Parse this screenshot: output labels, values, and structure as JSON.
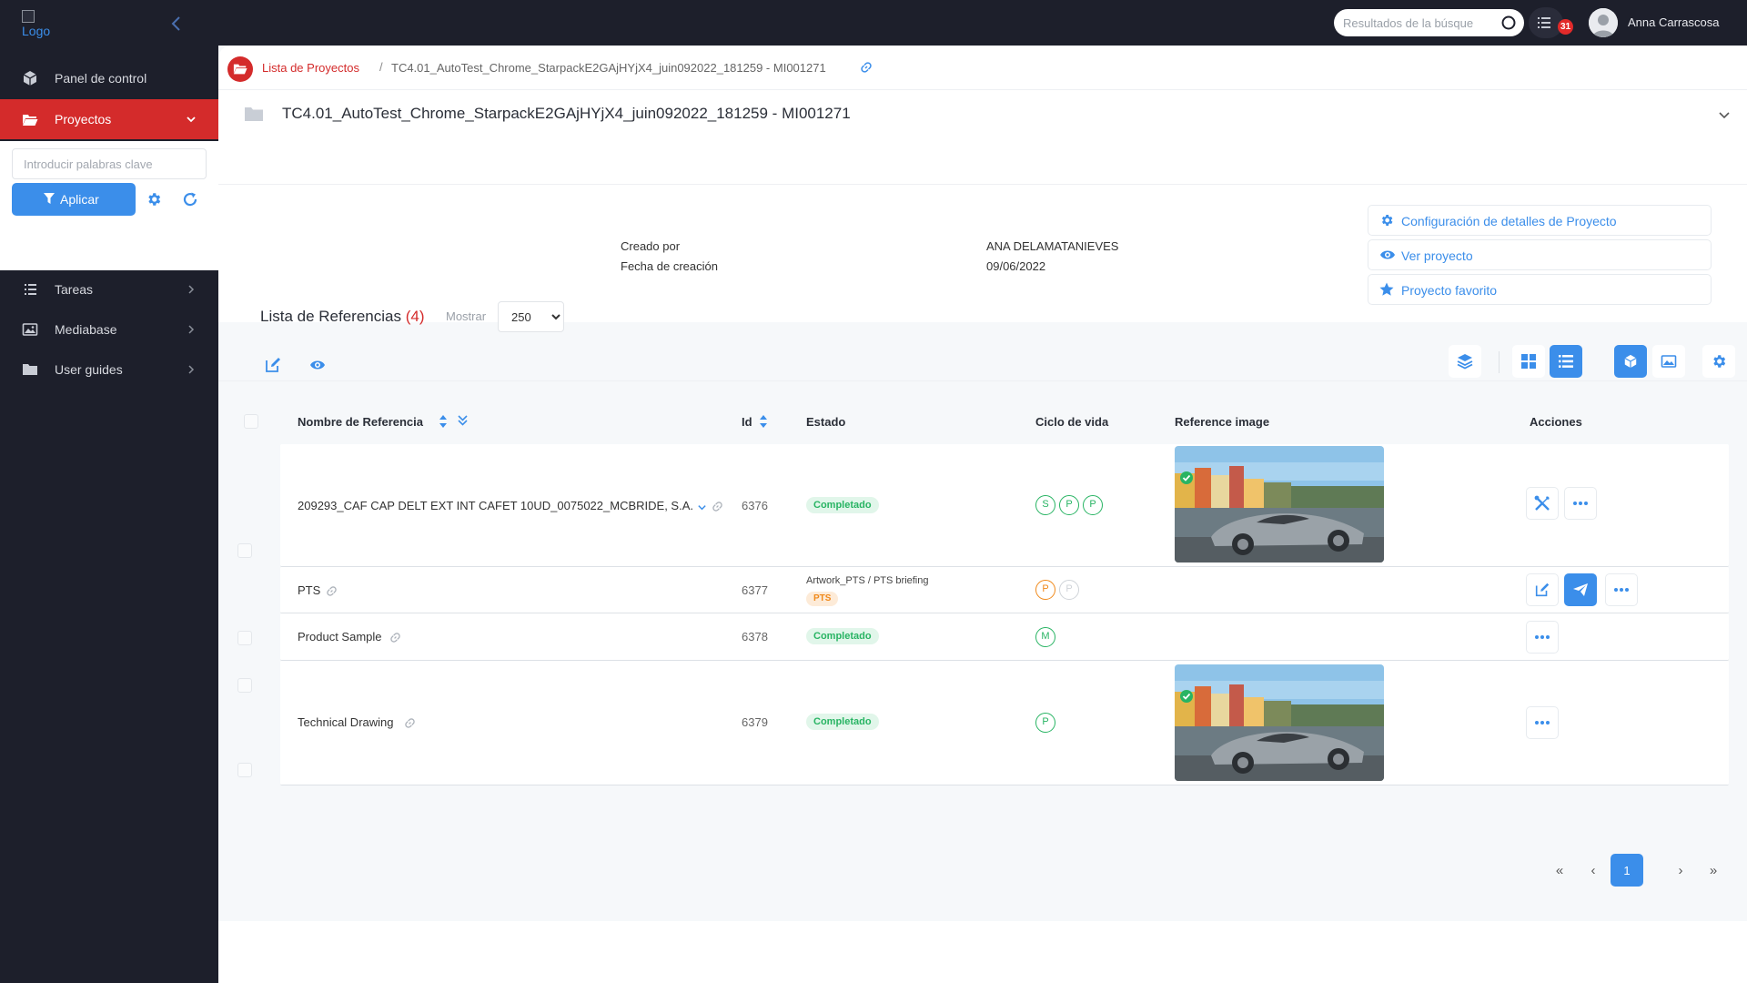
{
  "topbar": {
    "logo_alt": "Logo",
    "search_placeholder": "Resultados de la búsque",
    "notif_count": "31",
    "user_name": "Anna Carrascosa"
  },
  "sidebar": {
    "items": [
      {
        "label": "Panel de control",
        "icon": "cube-icon"
      },
      {
        "label": "Proyectos",
        "icon": "folder-open-icon",
        "active": true
      },
      {
        "label": "Tareas",
        "icon": "list-icon"
      },
      {
        "label": "Mediabase",
        "icon": "image-icon"
      },
      {
        "label": "User guides",
        "icon": "folder-icon"
      }
    ],
    "filter": {
      "keywords_placeholder": "Introducir palabras clave",
      "apply_label": "Aplicar"
    }
  },
  "breadcrumb": {
    "parent": "Lista de Proyectos",
    "separator": "/",
    "current": "TC4.01_AutoTest_Chrome_StarpackE2GAjHYjX4_juin092022_181259 - MI001271"
  },
  "project": {
    "title": "TC4.01_AutoTest_Chrome_StarpackE2GAjHYjX4_juin092022_181259 - MI001271",
    "created_by_label": "Creado por",
    "created_by_value": "ANA DELAMATANIEVES",
    "created_date_label": "Fecha de creación",
    "created_date_value": "09/06/2022",
    "actions": [
      {
        "label": "Configuración de detalles de Proyecto",
        "icon": "gear-icon"
      },
      {
        "label": "Ver proyecto",
        "icon": "eye-icon"
      },
      {
        "label": "Proyecto favorito",
        "icon": "star-icon"
      }
    ]
  },
  "references": {
    "title": "Lista de Referencias",
    "count_display": "(4)",
    "show_label": "Mostrar",
    "show_value": "250",
    "show_options": [
      "250"
    ],
    "columns": {
      "name": "Nombre de Referencia",
      "id": "Id",
      "status": "Estado",
      "lifecycle": "Ciclo de vida",
      "image": "Reference image",
      "actions": "Acciones"
    },
    "rows": [
      {
        "name": "209293_CAF CAP DELT EXT INT CAFET 10UD_0075022_MCBRIDE, S.A.",
        "id": "6376",
        "status": "Completado",
        "lifecycle": [
          "S",
          "P",
          "P"
        ]
      },
      {
        "name": "PTS",
        "id": "6377",
        "status_text": "Artwork_PTS / PTS briefing",
        "status": "PTS",
        "lifecycle": [
          "P",
          "P"
        ]
      },
      {
        "name": "Product Sample",
        "id": "6378",
        "status": "Completado",
        "lifecycle": [
          "M"
        ]
      },
      {
        "name": "Technical Drawing",
        "id": "6379",
        "status": "Completado",
        "lifecycle": [
          "P"
        ]
      }
    ]
  },
  "pagination": {
    "first": "«",
    "prev": "‹",
    "current": "1",
    "next": "›",
    "last": "»"
  },
  "colors": {
    "sidebar_bg": "#1d1f2b",
    "active_red": "#d42b2b",
    "accent_blue": "#3b8eea",
    "success_green": "#28b463",
    "warning_orange": "#f0891a"
  }
}
